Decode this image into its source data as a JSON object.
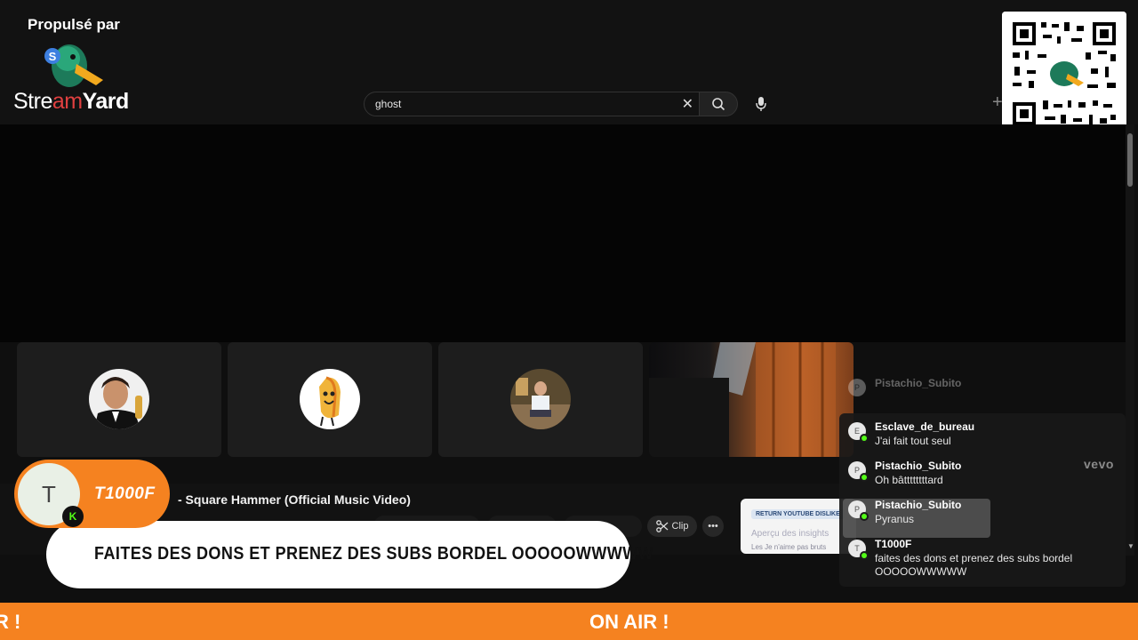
{
  "branding": {
    "powered_by": "Propulsé par",
    "logo_text_a": "Stre",
    "logo_text_b": "am",
    "logo_text_c": "Yard"
  },
  "search": {
    "value": "ghost",
    "clear_icon": "close-icon",
    "search_icon": "search-icon",
    "mic_icon": "microphone-icon"
  },
  "video": {
    "title": "- Square Hammer (Official Music Video)",
    "clip_label": "Clip",
    "more_icon": "more-icon"
  },
  "dislike_card": {
    "badge": "RETURN YOUTUBE DISLIKE",
    "line1": "Aperçu des insights",
    "line2": "Les Je n'aime pas bruts"
  },
  "participants": [
    {
      "name": "participant-1"
    },
    {
      "name": "participant-2"
    },
    {
      "name": "participant-3"
    },
    {
      "name": "participant-4-camera"
    }
  ],
  "chat": {
    "messages": [
      {
        "initial": "P",
        "name": "Pistachio_Subito",
        "text": "",
        "faded": true
      },
      {
        "initial": "E",
        "name": "Esclave_de_bureau",
        "text": "J'ai fait tout seul"
      },
      {
        "initial": "P",
        "name": "Pistachio_Subito",
        "text": "Oh bâttttttttard"
      },
      {
        "initial": "P",
        "name": "Pistachio_Subito",
        "text": "Pyranus"
      },
      {
        "initial": "T",
        "name": "T1000F",
        "text": "faites des dons et prenez des subs bordel OOOOOWWWWW"
      }
    ],
    "vevo": "vevo"
  },
  "banner": {
    "initial": "T",
    "platform_badge": "K",
    "username": "T1000F",
    "message": "FAITES DES DONS ET PRENEZ DES SUBS BORDEL OOOOOWWWWW"
  },
  "ticker": {
    "left_text": "R !",
    "center_text": "ON AIR !"
  },
  "colors": {
    "accent": "#f58220",
    "kick_green": "#53fc18",
    "background": "#0f0f0f"
  }
}
